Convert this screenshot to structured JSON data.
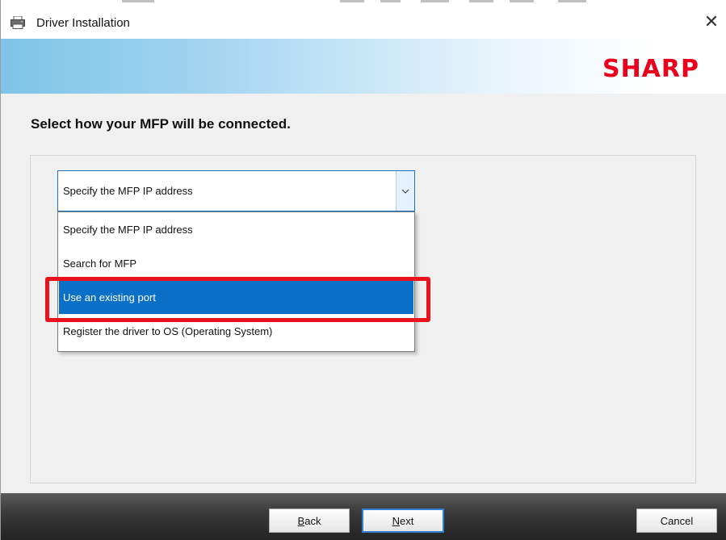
{
  "window": {
    "title": "Driver Installation",
    "close_glyph": "✕",
    "icon": "printer-icon"
  },
  "banner": {
    "logo_text": "SHARP",
    "logo_color": "#e8001c"
  },
  "main": {
    "heading": "Select how your MFP will be connected.",
    "combo": {
      "selected_value": "Specify the MFP IP address",
      "expanded": true,
      "options": [
        "Specify the MFP IP address",
        "Search for MFP",
        "Use an existing port",
        "Register the driver to OS (Operating System)"
      ],
      "highlighted_index": 2
    }
  },
  "footer": {
    "back_label_mnemonic": "B",
    "back_label_rest": "ack",
    "next_label_mnemonic": "N",
    "next_label_rest": "ext",
    "cancel_label": "Cancel"
  },
  "colors": {
    "accent": "#0a6fc7",
    "annotation": "#e8131b"
  }
}
